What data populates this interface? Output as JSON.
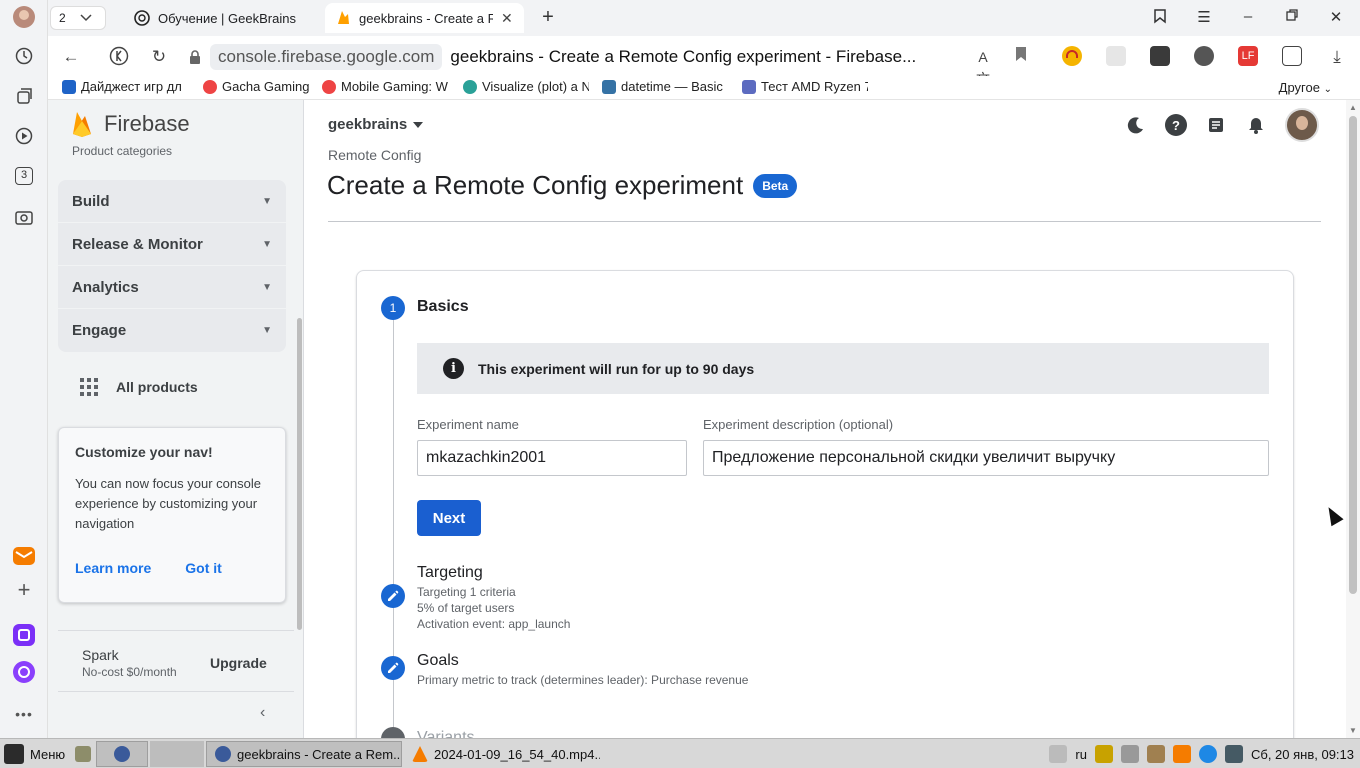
{
  "browser": {
    "tab_count": "2",
    "tabs": [
      {
        "title": "Обучение | GeekBrains - "
      },
      {
        "title": "geekbrains - Create a Re"
      }
    ],
    "url_host": "console.firebase.google.com",
    "page_title": "geekbrains - Create a Remote Config experiment - Firebase...",
    "bookmarks": [
      {
        "label": "Дайджест игр дл"
      },
      {
        "label": "Gacha Gaming"
      },
      {
        "label": "Mobile Gaming: W"
      },
      {
        "label": "Visualize (plot) a N"
      },
      {
        "label": "datetime — Basic"
      },
      {
        "label": "Тест AMD Ryzen 7"
      }
    ],
    "bookmarks_other": "Другое",
    "left_rail_badge": "3"
  },
  "sidebar": {
    "brand": "Firebase",
    "product_categories": "Product categories",
    "groups": [
      {
        "label": "Build"
      },
      {
        "label": "Release & Monitor"
      },
      {
        "label": "Analytics"
      },
      {
        "label": "Engage"
      }
    ],
    "all_products": "All products",
    "customize_card": {
      "title": "Customize your nav!",
      "body": "You can now focus your console experience by customizing your navigation",
      "learn_more": "Learn more",
      "got_it": "Got it"
    },
    "plan": {
      "name": "Spark",
      "cost": "No-cost $0/month",
      "upgrade": "Upgrade"
    }
  },
  "header": {
    "project": "geekbrains",
    "breadcrumb": "Remote Config",
    "title": "Create a Remote Config experiment",
    "badge": "Beta"
  },
  "steps": {
    "basics": {
      "number": "1",
      "title": "Basics",
      "info": "This experiment will run for up to 90 days",
      "name_label": "Experiment name",
      "name_value": "mkazachkin2001",
      "desc_label": "Experiment description (optional)",
      "desc_value": "Предложение персональной скидки увеличит выручку",
      "next": "Next"
    },
    "targeting": {
      "title": "Targeting",
      "lines": [
        "Targeting 1 criteria",
        "5% of target users",
        "Activation event: app_launch"
      ]
    },
    "goals": {
      "title": "Goals",
      "line": "Primary metric to track (determines leader): Purchase revenue"
    },
    "variants": {
      "title": "Variants"
    }
  },
  "taskbar": {
    "menu": "Меню",
    "windows": [
      {
        "label": "geekbrains - Create a Rem..."
      },
      {
        "label": "2024-01-09_16_54_40.mp4..."
      }
    ],
    "lang": "ru",
    "clock": "Сб, 20 янв, 09:13"
  },
  "colors": {
    "primary": "#1967d2",
    "sidebar_bg": "#f1f3f4",
    "info_bg": "#e8eaed"
  }
}
